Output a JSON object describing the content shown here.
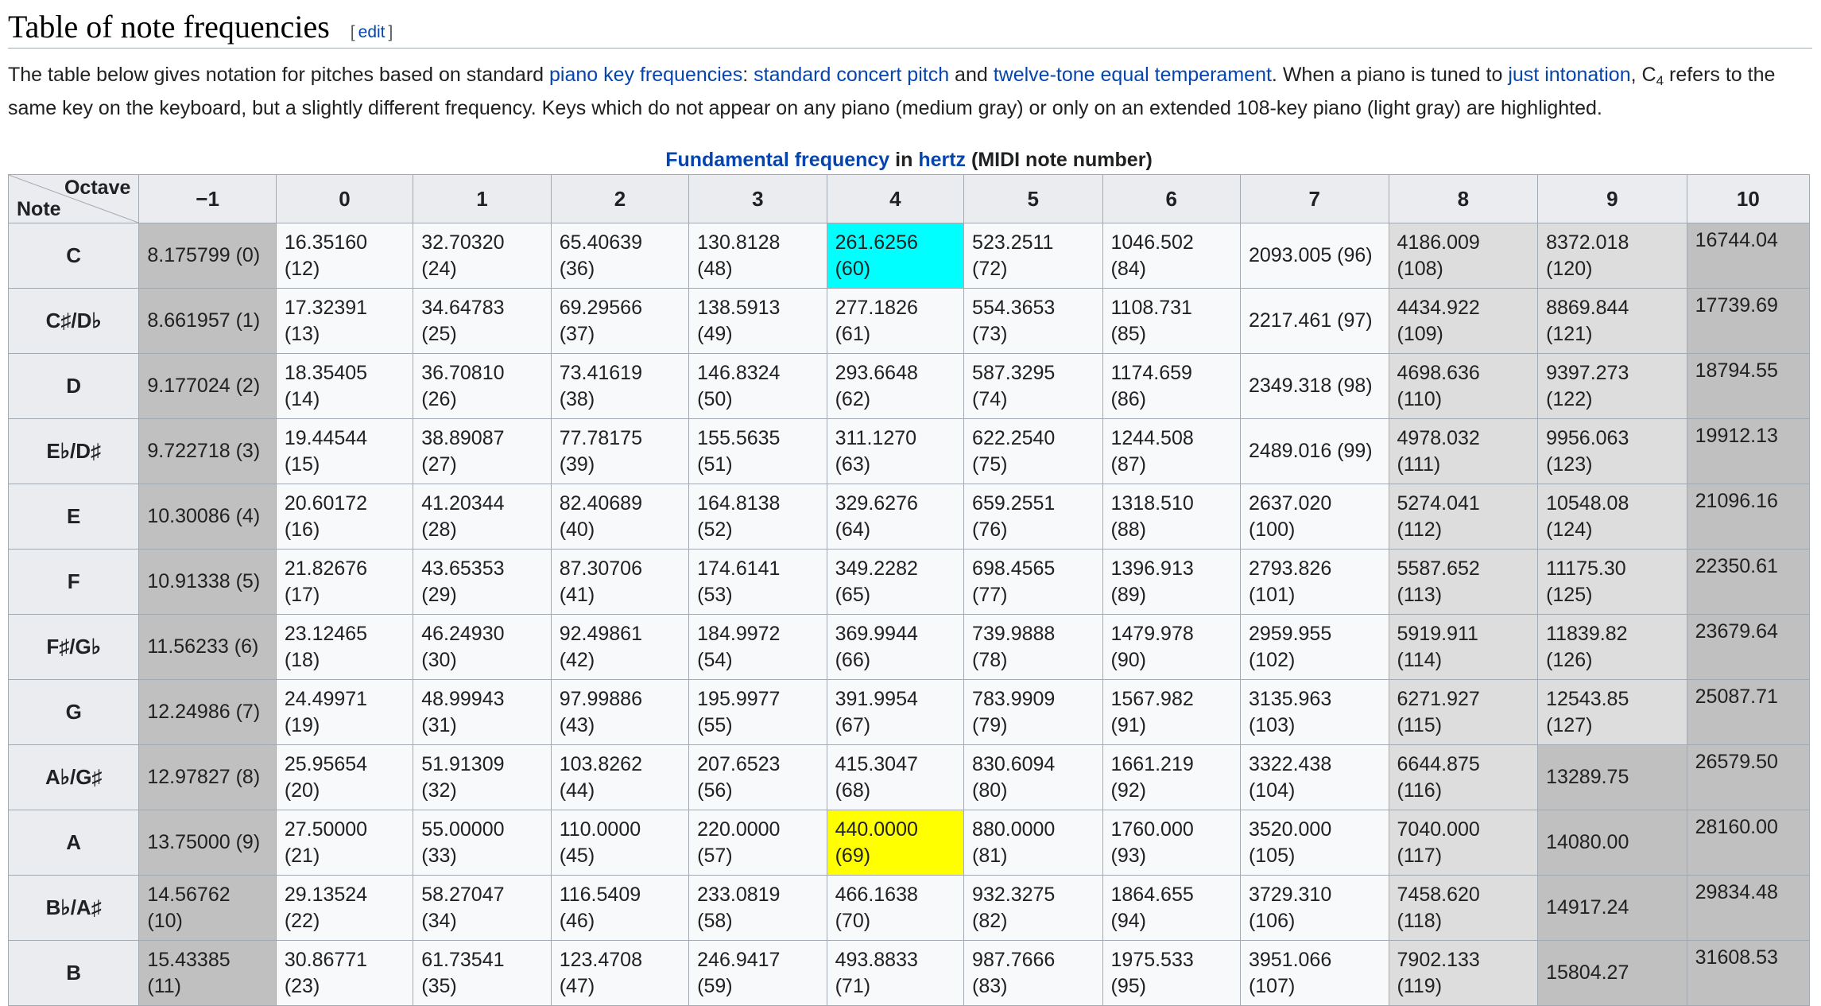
{
  "heading": {
    "title": "Table of note frequencies",
    "edit_open": "[",
    "edit_label": "edit",
    "edit_close": "]"
  },
  "intro": {
    "t1": "The table below gives notation for pitches based on standard ",
    "link1": "piano key frequencies",
    "t2": ": ",
    "link2": "standard concert pitch",
    "t3": " and ",
    "link3": "twelve-tone equal temperament",
    "t4": ". When a piano is tuned to ",
    "link4": "just intonation",
    "t5": ", C",
    "sub": "4",
    "t6": " refers to the same key on the keyboard, but a slightly different frequency. Keys which do not appear on any piano (medium gray) or only on an extended 108-key piano (light gray) are highlighted."
  },
  "caption": {
    "link1": "Fundamental frequency",
    "mid": " in ",
    "link2": "hertz",
    "tail": " (MIDI note number)"
  },
  "table": {
    "corner_octave": "Octave",
    "corner_note": "Note",
    "octaves": [
      "−1",
      "0",
      "1",
      "2",
      "3",
      "4",
      "5",
      "6",
      "7",
      "8",
      "9",
      "10"
    ],
    "rows": [
      {
        "note": "C",
        "cells": [
          [
            "8.175799 (0)"
          ],
          [
            "16.35160",
            "(12)"
          ],
          [
            "32.70320",
            "(24)"
          ],
          [
            "65.40639",
            "(36)"
          ],
          [
            "130.8128",
            "(48)"
          ],
          [
            "261.6256",
            "(60)"
          ],
          [
            "523.2511",
            "(72)"
          ],
          [
            "1046.502",
            "(84)"
          ],
          [
            "2093.005 (96)"
          ],
          [
            "4186.009",
            "(108)"
          ],
          [
            "8372.018",
            "(120)"
          ],
          [
            "16744.04"
          ]
        ]
      },
      {
        "note": "C♯/D♭",
        "cells": [
          [
            "8.661957 (1)"
          ],
          [
            "17.32391",
            "(13)"
          ],
          [
            "34.64783",
            "(25)"
          ],
          [
            "69.29566",
            "(37)"
          ],
          [
            "138.5913",
            "(49)"
          ],
          [
            "277.1826",
            "(61)"
          ],
          [
            "554.3653",
            "(73)"
          ],
          [
            "1108.731",
            "(85)"
          ],
          [
            "2217.461 (97)"
          ],
          [
            "4434.922",
            "(109)"
          ],
          [
            "8869.844",
            "(121)"
          ],
          [
            "17739.69"
          ]
        ]
      },
      {
        "note": "D",
        "cells": [
          [
            "9.177024 (2)"
          ],
          [
            "18.35405",
            "(14)"
          ],
          [
            "36.70810",
            "(26)"
          ],
          [
            "73.41619",
            "(38)"
          ],
          [
            "146.8324",
            "(50)"
          ],
          [
            "293.6648",
            "(62)"
          ],
          [
            "587.3295",
            "(74)"
          ],
          [
            "1174.659",
            "(86)"
          ],
          [
            "2349.318 (98)"
          ],
          [
            "4698.636",
            "(110)"
          ],
          [
            "9397.273",
            "(122)"
          ],
          [
            "18794.55"
          ]
        ]
      },
      {
        "note": "E♭/D♯",
        "cells": [
          [
            "9.722718 (3)"
          ],
          [
            "19.44544",
            "(15)"
          ],
          [
            "38.89087",
            "(27)"
          ],
          [
            "77.78175",
            "(39)"
          ],
          [
            "155.5635",
            "(51)"
          ],
          [
            "311.1270",
            "(63)"
          ],
          [
            "622.2540",
            "(75)"
          ],
          [
            "1244.508",
            "(87)"
          ],
          [
            "2489.016 (99)"
          ],
          [
            "4978.032",
            "(111)"
          ],
          [
            "9956.063",
            "(123)"
          ],
          [
            "19912.13"
          ]
        ]
      },
      {
        "note": "E",
        "cells": [
          [
            "10.30086 (4)"
          ],
          [
            "20.60172",
            "(16)"
          ],
          [
            "41.20344",
            "(28)"
          ],
          [
            "82.40689",
            "(40)"
          ],
          [
            "164.8138",
            "(52)"
          ],
          [
            "329.6276",
            "(64)"
          ],
          [
            "659.2551",
            "(76)"
          ],
          [
            "1318.510",
            "(88)"
          ],
          [
            "2637.020",
            "(100)"
          ],
          [
            "5274.041",
            "(112)"
          ],
          [
            "10548.08",
            "(124)"
          ],
          [
            "21096.16"
          ]
        ]
      },
      {
        "note": "F",
        "cells": [
          [
            "10.91338 (5)"
          ],
          [
            "21.82676",
            "(17)"
          ],
          [
            "43.65353",
            "(29)"
          ],
          [
            "87.30706",
            "(41)"
          ],
          [
            "174.6141",
            "(53)"
          ],
          [
            "349.2282",
            "(65)"
          ],
          [
            "698.4565",
            "(77)"
          ],
          [
            "1396.913",
            "(89)"
          ],
          [
            "2793.826",
            "(101)"
          ],
          [
            "5587.652",
            "(113)"
          ],
          [
            "11175.30",
            "(125)"
          ],
          [
            "22350.61"
          ]
        ]
      },
      {
        "note": "F♯/G♭",
        "cells": [
          [
            "11.56233 (6)"
          ],
          [
            "23.12465",
            "(18)"
          ],
          [
            "46.24930",
            "(30)"
          ],
          [
            "92.49861",
            "(42)"
          ],
          [
            "184.9972",
            "(54)"
          ],
          [
            "369.9944",
            "(66)"
          ],
          [
            "739.9888",
            "(78)"
          ],
          [
            "1479.978",
            "(90)"
          ],
          [
            "2959.955",
            "(102)"
          ],
          [
            "5919.911",
            "(114)"
          ],
          [
            "11839.82",
            "(126)"
          ],
          [
            "23679.64"
          ]
        ]
      },
      {
        "note": "G",
        "cells": [
          [
            "12.24986 (7)"
          ],
          [
            "24.49971",
            "(19)"
          ],
          [
            "48.99943",
            "(31)"
          ],
          [
            "97.99886",
            "(43)"
          ],
          [
            "195.9977",
            "(55)"
          ],
          [
            "391.9954",
            "(67)"
          ],
          [
            "783.9909",
            "(79)"
          ],
          [
            "1567.982",
            "(91)"
          ],
          [
            "3135.963",
            "(103)"
          ],
          [
            "6271.927",
            "(115)"
          ],
          [
            "12543.85",
            "(127)"
          ],
          [
            "25087.71"
          ]
        ]
      },
      {
        "note": "A♭/G♯",
        "cells": [
          [
            "12.97827 (8)"
          ],
          [
            "25.95654",
            "(20)"
          ],
          [
            "51.91309",
            "(32)"
          ],
          [
            "103.8262",
            "(44)"
          ],
          [
            "207.6523",
            "(56)"
          ],
          [
            "415.3047",
            "(68)"
          ],
          [
            "830.6094",
            "(80)"
          ],
          [
            "1661.219",
            "(92)"
          ],
          [
            "3322.438",
            "(104)"
          ],
          [
            "6644.875",
            "(116)"
          ],
          [
            "13289.75"
          ],
          [
            "26579.50"
          ]
        ]
      },
      {
        "note": "A",
        "cells": [
          [
            "13.75000 (9)"
          ],
          [
            "27.50000",
            "(21)"
          ],
          [
            "55.00000",
            "(33)"
          ],
          [
            "110.0000",
            "(45)"
          ],
          [
            "220.0000",
            "(57)"
          ],
          [
            "440.0000",
            "(69)"
          ],
          [
            "880.0000",
            "(81)"
          ],
          [
            "1760.000",
            "(93)"
          ],
          [
            "3520.000",
            "(105)"
          ],
          [
            "7040.000",
            "(117)"
          ],
          [
            "14080.00"
          ],
          [
            "28160.00"
          ]
        ]
      },
      {
        "note": "B♭/A♯",
        "cells": [
          [
            "14.56762",
            "(10)"
          ],
          [
            "29.13524",
            "(22)"
          ],
          [
            "58.27047",
            "(34)"
          ],
          [
            "116.5409",
            "(46)"
          ],
          [
            "233.0819",
            "(58)"
          ],
          [
            "466.1638",
            "(70)"
          ],
          [
            "932.3275",
            "(82)"
          ],
          [
            "1864.655",
            "(94)"
          ],
          [
            "3729.310",
            "(106)"
          ],
          [
            "7458.620",
            "(118)"
          ],
          [
            "14917.24"
          ],
          [
            "29834.48"
          ]
        ]
      },
      {
        "note": "B",
        "cells": [
          [
            "15.43385",
            "(11)"
          ],
          [
            "30.86771",
            "(23)"
          ],
          [
            "61.73541",
            "(35)"
          ],
          [
            "123.4708",
            "(47)"
          ],
          [
            "246.9417",
            "(59)"
          ],
          [
            "493.8833",
            "(71)"
          ],
          [
            "987.7666",
            "(83)"
          ],
          [
            "1975.533",
            "(95)"
          ],
          [
            "3951.066",
            "(107)"
          ],
          [
            "7902.133",
            "(119)"
          ],
          [
            "15804.27"
          ],
          [
            "31608.53"
          ]
        ]
      }
    ],
    "colors": {
      "medium_gray": "#c0c0c0",
      "light_gray": "#dddddd",
      "highlight_c4": "#00ffff",
      "highlight_a4": "#ffff00",
      "link": "#0645ad",
      "header_bg": "#eaecf0",
      "cell_bg": "#f8f9fa"
    }
  }
}
